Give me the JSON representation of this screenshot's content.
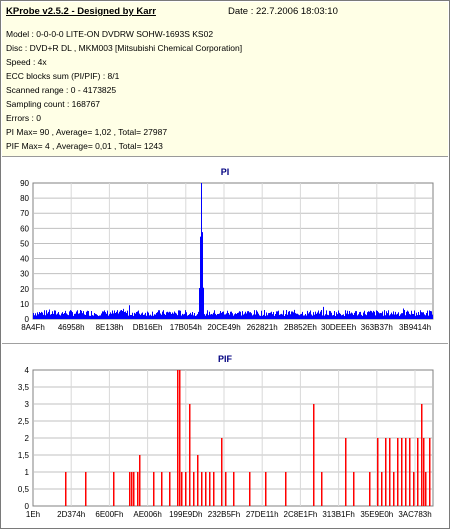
{
  "header": {
    "title": "KProbe v2.5.2 - Designed by Karr",
    "date": "Date : 22.7.2006 18:03:10"
  },
  "info_lines": [
    "Model : 0-0-0-0 LITE-ON DVDRW SOHW-1693S KS02",
    "Disc : DVD+R DL , MKM003 [Mitsubishi Chemical Corporation]",
    "Speed : 4x",
    "ECC blocks sum (PI/PIF) : 8/1",
    "Scanned range : 0 - 4173825",
    "Sampling count : 168767",
    "Errors : 0",
    "PI Max= 90 , Average= 1,02 , Total= 27987",
    "PIF Max= 4 , Average= 0,01 , Total= 1243"
  ],
  "colors": {
    "pi": "#0000ff",
    "pif": "#ff0000",
    "title": "#000080",
    "info_bg": "#ffffe6"
  },
  "chart_data": [
    {
      "type": "bar",
      "title": "PI",
      "ylim": [
        0,
        90
      ],
      "yticks": [
        0,
        10,
        20,
        30,
        40,
        50,
        60,
        70,
        80,
        90
      ],
      "xtick_labels": [
        "8A4Fh",
        "46958h",
        "8E138h",
        "DB16Eh",
        "17B054h",
        "20CE49h",
        "262821h",
        "2B852Eh",
        "30DEEEh",
        "363B37h",
        "3B9414h"
      ],
      "baseline_level": 2,
      "peak_position": 0.42,
      "peak_value": 90,
      "grid": true
    },
    {
      "type": "bar",
      "title": "PIF",
      "ylim": [
        0,
        4
      ],
      "yticks": [
        0,
        0.5,
        1,
        1.5,
        2,
        2.5,
        3,
        3.5,
        4
      ],
      "ytick_labels": [
        "0",
        "0,5",
        "1",
        "1,5",
        "2",
        "2,5",
        "3",
        "3,5",
        "4"
      ],
      "xtick_labels": [
        "1Eh",
        "2D374h",
        "6E00Fh",
        "AE006h",
        "199E9Dh",
        "232B5Fh",
        "27DE11h",
        "2C8E1Fh",
        "313B1Fh",
        "35E9E0h",
        "3AC783h"
      ],
      "bars": [
        [
          0.08,
          1
        ],
        [
          0.13,
          1
        ],
        [
          0.2,
          1
        ],
        [
          0.24,
          1
        ],
        [
          0.245,
          1
        ],
        [
          0.25,
          1
        ],
        [
          0.26,
          1
        ],
        [
          0.265,
          1.5
        ],
        [
          0.3,
          1
        ],
        [
          0.32,
          1
        ],
        [
          0.34,
          1
        ],
        [
          0.36,
          4
        ],
        [
          0.365,
          4
        ],
        [
          0.37,
          1
        ],
        [
          0.38,
          1
        ],
        [
          0.39,
          3
        ],
        [
          0.4,
          1
        ],
        [
          0.41,
          1.5
        ],
        [
          0.42,
          1
        ],
        [
          0.43,
          1
        ],
        [
          0.44,
          1
        ],
        [
          0.45,
          1
        ],
        [
          0.47,
          2
        ],
        [
          0.48,
          1
        ],
        [
          0.5,
          1
        ],
        [
          0.54,
          1
        ],
        [
          0.58,
          1
        ],
        [
          0.63,
          1
        ],
        [
          0.7,
          3
        ],
        [
          0.72,
          1
        ],
        [
          0.78,
          2
        ],
        [
          0.8,
          1
        ],
        [
          0.84,
          1
        ],
        [
          0.86,
          2
        ],
        [
          0.87,
          1
        ],
        [
          0.88,
          2
        ],
        [
          0.89,
          2
        ],
        [
          0.9,
          1
        ],
        [
          0.91,
          2
        ],
        [
          0.92,
          2
        ],
        [
          0.93,
          2
        ],
        [
          0.94,
          2
        ],
        [
          0.95,
          1
        ],
        [
          0.96,
          2
        ],
        [
          0.97,
          3
        ],
        [
          0.975,
          2
        ],
        [
          0.98,
          1
        ],
        [
          0.99,
          2
        ]
      ],
      "grid": true
    }
  ]
}
